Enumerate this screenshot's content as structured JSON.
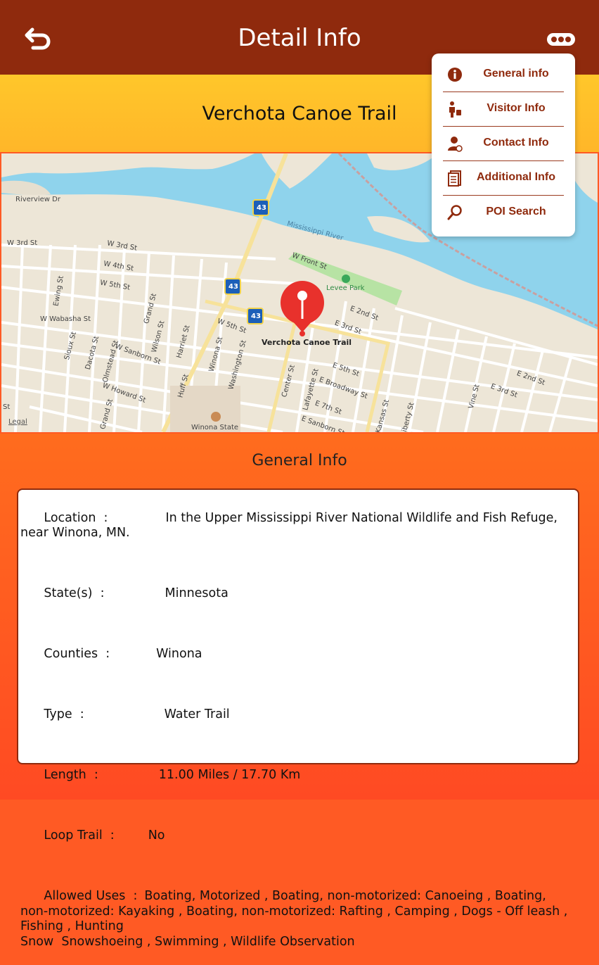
{
  "header": {
    "title": "Detail Info",
    "back_icon": "back-arrow-icon",
    "more_icon": "more-dots-icon"
  },
  "trail": {
    "name": "Verchota Canoe Trail"
  },
  "menu": {
    "items": [
      {
        "label": "General info",
        "icon": "info-icon"
      },
      {
        "label": "Visitor Info",
        "icon": "visitor-icon"
      },
      {
        "label": "Contact Info",
        "icon": "contact-icon"
      },
      {
        "label": "Additional Info",
        "icon": "document-icon"
      },
      {
        "label": "POI Search",
        "icon": "search-icon"
      }
    ]
  },
  "map": {
    "pin_label": "Verchota Canoe Trail",
    "legal": "Legal",
    "labels": {
      "riverview": "Riverview Dr",
      "w3rd_left": "W 3rd St",
      "w3rd": "W 3rd St",
      "w4th": "W 4th St",
      "w5th_left": "W 5th St",
      "wabasha": "W Wabasha St",
      "ewing": "Ewing St",
      "sioux": "Sioux St",
      "dacota": "Dacota St",
      "olmstead": "Olmstead St",
      "w_sanborn": "W Sanborn St",
      "wilson": "Wilson St",
      "grand": "Grand St",
      "harriet": "Harriet St",
      "huff": "Huff St",
      "winona_st": "Winona St",
      "washington": "Washington St",
      "w5th": "W 5th St",
      "whoward": "W Howard St",
      "grand2": "Grand St",
      "mississippi": "Mississippi River",
      "wfront": "W Front St",
      "levee": "Levee Park",
      "e2nd": "E 2nd St",
      "e3rd": "E 3rd St",
      "e5th": "E 5th St",
      "ebroadway": "E Broadway St",
      "e7th": "E 7th St",
      "esanborn": "E Sanborn St",
      "center": "Center St",
      "lafayette": "Lafayette St",
      "kansas": "Kansas St",
      "liberty": "Liberty St",
      "vine": "Vine St",
      "e2nd_right": "E 2nd St",
      "e3rd_right": "E 3rd St",
      "st": "St",
      "winona_state": "Winona State",
      "hwy43_a": "43",
      "hwy43_b": "43",
      "hwy43_c": "43"
    }
  },
  "general_info": {
    "title": "General Info",
    "rows": [
      {
        "label": "Location  :",
        "value": "In the Upper Mississippi River National Wildlife and Fish Refuge, near Winona, MN."
      },
      {
        "label": "State(s)  :",
        "value": "Minnesota"
      },
      {
        "label": "Counties  :",
        "value": "Winona"
      },
      {
        "label": "Type  :",
        "value": "Water Trail"
      },
      {
        "label": "Length  :",
        "value": "11.00 Miles / 17.70 Km"
      },
      {
        "label": "Loop Trail  :",
        "value": "No"
      },
      {
        "label": "Allowed Uses  :",
        "value": "Boating, Motorized , Boating, non-motorized: Canoeing , Boating, non-motorized: Kayaking , Boating, non-motorized: Rafting , Camping , Dogs - Off leash , Fishing , Hunting\nSnow  Snowshoeing , Swimming , Wildlife Observation"
      }
    ]
  },
  "colors": {
    "header_bg": "#8f2a0d",
    "title_band": "#ffc72a",
    "accent": "#8f2a0d",
    "water": "#8fd3ec",
    "park": "#b7e3a4",
    "pin": "#e8312c"
  }
}
